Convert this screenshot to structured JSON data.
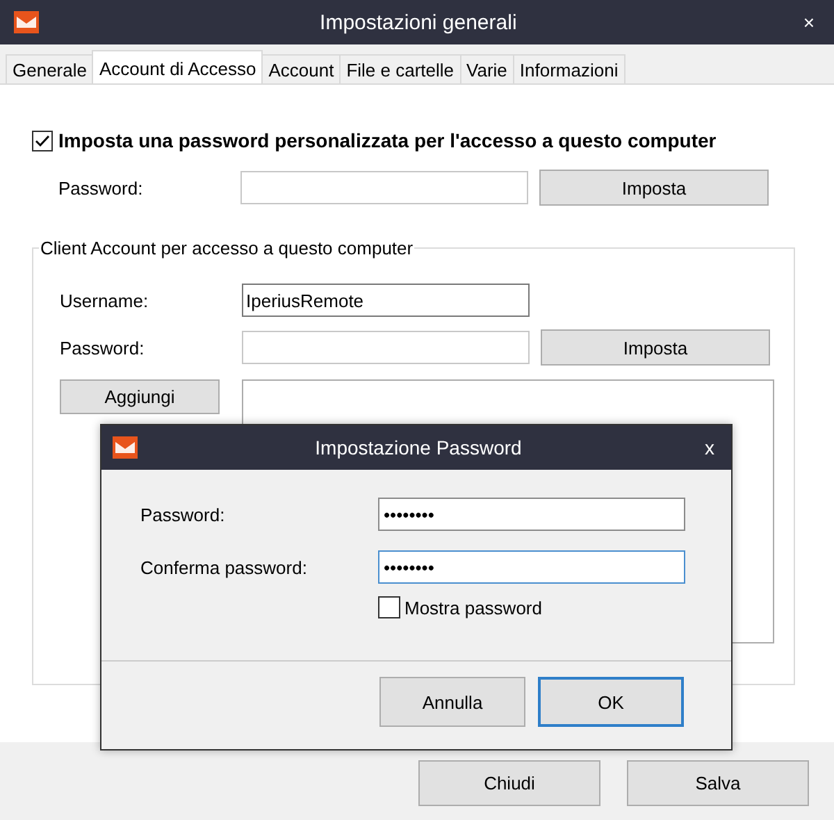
{
  "window": {
    "title": "Impostazioni generali",
    "close": "×"
  },
  "tabs": [
    {
      "label": "Generale",
      "selected": false
    },
    {
      "label": "Account di Accesso",
      "selected": true
    },
    {
      "label": "Account",
      "selected": false
    },
    {
      "label": "File e cartelle",
      "selected": false
    },
    {
      "label": "Varie",
      "selected": false
    },
    {
      "label": "Informazioni",
      "selected": false
    }
  ],
  "custom_password": {
    "checked": true,
    "label": "Imposta una password personalizzata per l'accesso a questo computer",
    "password_label": "Password:",
    "button": "Imposta"
  },
  "client_account": {
    "title": "Client Account per accesso a questo computer",
    "username_label": "Username:",
    "username_value": "IperiusRemote",
    "password_label": "Password:",
    "button": "Imposta",
    "list_buttons": [
      "Aggiungi"
    ]
  },
  "footer_buttons": [
    "Chiudi",
    "Salva"
  ],
  "dialog": {
    "title": "Impostazione Password",
    "close": "x",
    "fields": [
      {
        "label": "Password:",
        "value": "••••••••",
        "focused": false
      },
      {
        "label": "Conferma password:",
        "value": "••••••••",
        "focused": true
      }
    ],
    "show_password": {
      "label": "Mostra password",
      "checked": false
    },
    "buttons": [
      {
        "label": "Annulla",
        "default": false
      },
      {
        "label": "OK",
        "default": true
      }
    ]
  }
}
